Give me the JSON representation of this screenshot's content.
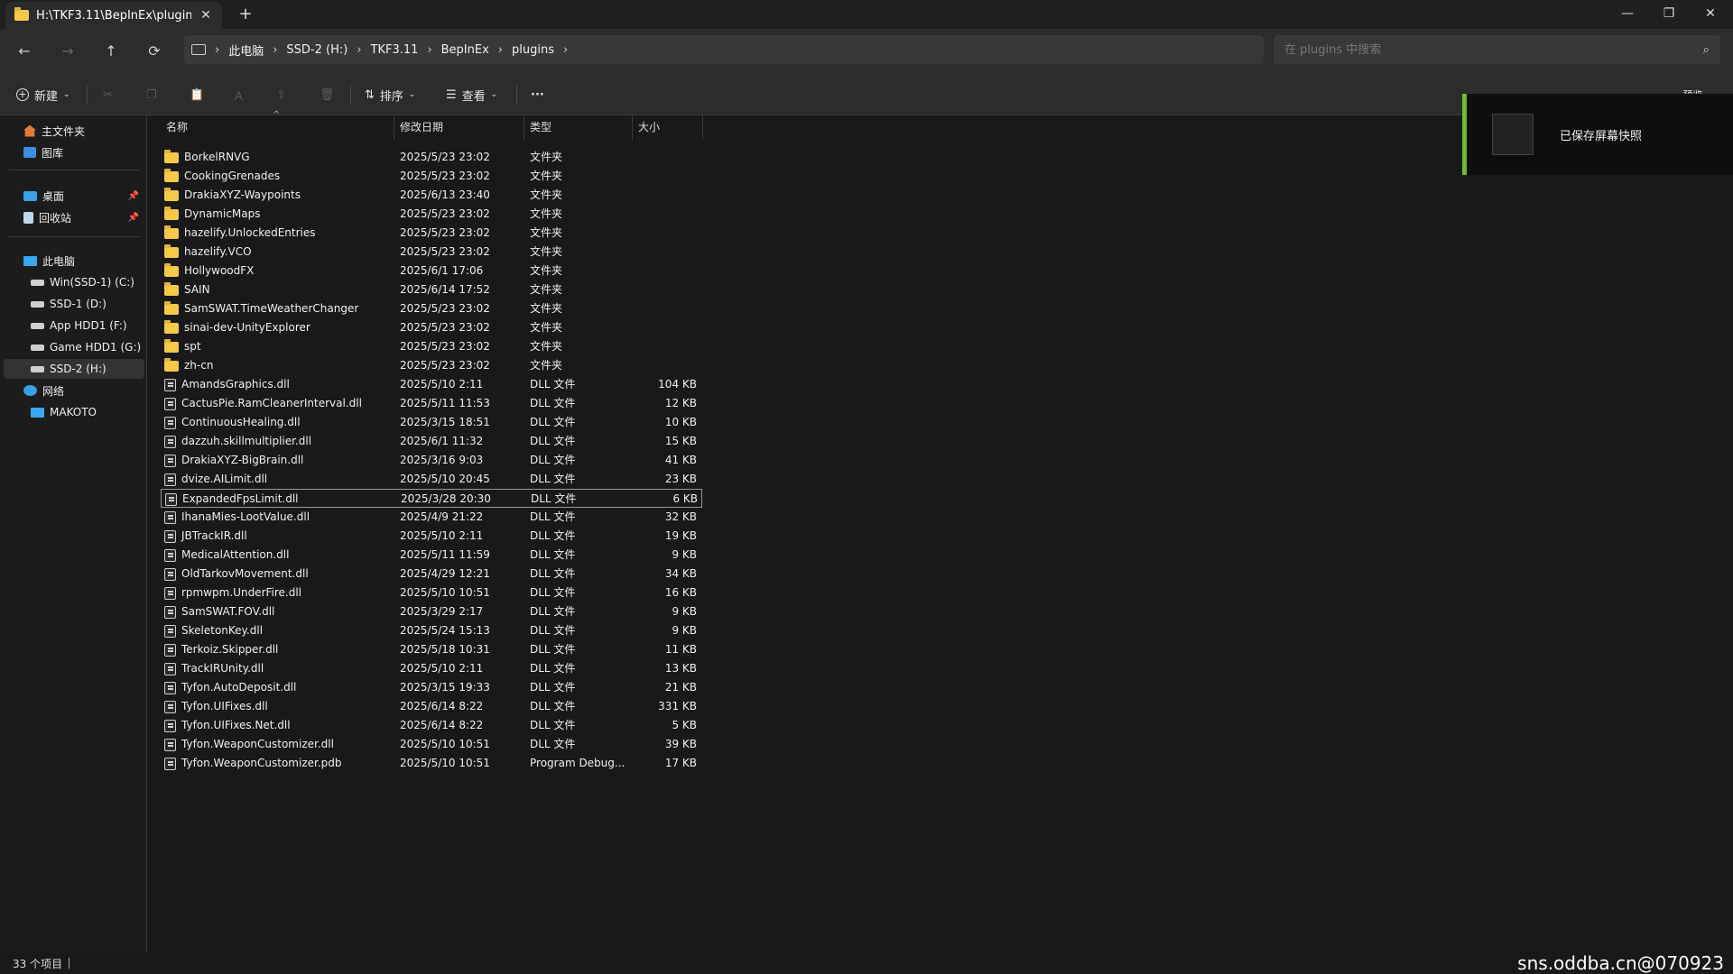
{
  "window": {
    "tab_title": "H:\\TKF3.11\\BepInEx\\plugins",
    "new_tab": "+",
    "min": "—",
    "max": "❐",
    "close": "✕"
  },
  "nav": {
    "back": "←",
    "forward": "→",
    "up": "↑",
    "refresh": "⟳",
    "breadcrumbs": [
      "此电脑",
      "SSD-2 (H:)",
      "TKF3.11",
      "BepInEx",
      "plugins"
    ],
    "search_placeholder": "在 plugins 中搜索"
  },
  "toolbar": {
    "new_label": "新建",
    "sort_label": "排序",
    "view_label": "查看",
    "more_label": "···",
    "preview_label": "预览"
  },
  "sidebar": {
    "home": "主文件夹",
    "gallery": "图库",
    "desktop": "桌面",
    "recycle": "回收站",
    "this_pc": "此电脑",
    "drives": [
      "Win(SSD-1) (C:)",
      "SSD-1 (D:)",
      "App HDD1 (F:)",
      "Game HDD1 (G:)",
      "SSD-2 (H:)"
    ],
    "network": "网络",
    "network_host": "MAKOTO"
  },
  "columns": {
    "name": "名称",
    "date": "修改日期",
    "type": "类型",
    "size": "大小"
  },
  "files": [
    {
      "name": "BorkelRNVG",
      "date": "2025/5/23 23:02",
      "type": "文件夹",
      "size": "",
      "kind": "folder"
    },
    {
      "name": "CookingGrenades",
      "date": "2025/5/23 23:02",
      "type": "文件夹",
      "size": "",
      "kind": "folder"
    },
    {
      "name": "DrakiaXYZ-Waypoints",
      "date": "2025/6/13 23:40",
      "type": "文件夹",
      "size": "",
      "kind": "folder"
    },
    {
      "name": "DynamicMaps",
      "date": "2025/5/23 23:02",
      "type": "文件夹",
      "size": "",
      "kind": "folder"
    },
    {
      "name": "hazelify.UnlockedEntries",
      "date": "2025/5/23 23:02",
      "type": "文件夹",
      "size": "",
      "kind": "folder"
    },
    {
      "name": "hazelify.VCO",
      "date": "2025/5/23 23:02",
      "type": "文件夹",
      "size": "",
      "kind": "folder"
    },
    {
      "name": "HollywoodFX",
      "date": "2025/6/1 17:06",
      "type": "文件夹",
      "size": "",
      "kind": "folder"
    },
    {
      "name": "SAIN",
      "date": "2025/6/14 17:52",
      "type": "文件夹",
      "size": "",
      "kind": "folder"
    },
    {
      "name": "SamSWAT.TimeWeatherChanger",
      "date": "2025/5/23 23:02",
      "type": "文件夹",
      "size": "",
      "kind": "folder"
    },
    {
      "name": "sinai-dev-UnityExplorer",
      "date": "2025/5/23 23:02",
      "type": "文件夹",
      "size": "",
      "kind": "folder"
    },
    {
      "name": "spt",
      "date": "2025/5/23 23:02",
      "type": "文件夹",
      "size": "",
      "kind": "folder"
    },
    {
      "name": "zh-cn",
      "date": "2025/5/23 23:02",
      "type": "文件夹",
      "size": "",
      "kind": "folder"
    },
    {
      "name": "AmandsGraphics.dll",
      "date": "2025/5/10 2:11",
      "type": "DLL 文件",
      "size": "104 KB",
      "kind": "dll"
    },
    {
      "name": "CactusPie.RamCleanerInterval.dll",
      "date": "2025/5/11 11:53",
      "type": "DLL 文件",
      "size": "12 KB",
      "kind": "dll"
    },
    {
      "name": "ContinuousHealing.dll",
      "date": "2025/3/15 18:51",
      "type": "DLL 文件",
      "size": "10 KB",
      "kind": "dll"
    },
    {
      "name": "dazzuh.skillmultiplier.dll",
      "date": "2025/6/1 11:32",
      "type": "DLL 文件",
      "size": "15 KB",
      "kind": "dll"
    },
    {
      "name": "DrakiaXYZ-BigBrain.dll",
      "date": "2025/3/16 9:03",
      "type": "DLL 文件",
      "size": "41 KB",
      "kind": "dll"
    },
    {
      "name": "dvize.AILimit.dll",
      "date": "2025/5/10 20:45",
      "type": "DLL 文件",
      "size": "23 KB",
      "kind": "dll"
    },
    {
      "name": "ExpandedFpsLimit.dll",
      "date": "2025/3/28 20:30",
      "type": "DLL 文件",
      "size": "6 KB",
      "kind": "dll"
    },
    {
      "name": "IhanaMies-LootValue.dll",
      "date": "2025/4/9 21:22",
      "type": "DLL 文件",
      "size": "32 KB",
      "kind": "dll"
    },
    {
      "name": "JBTrackIR.dll",
      "date": "2025/5/10 2:11",
      "type": "DLL 文件",
      "size": "19 KB",
      "kind": "dll"
    },
    {
      "name": "MedicalAttention.dll",
      "date": "2025/5/11 11:59",
      "type": "DLL 文件",
      "size": "9 KB",
      "kind": "dll"
    },
    {
      "name": "OldTarkovMovement.dll",
      "date": "2025/4/29 12:21",
      "type": "DLL 文件",
      "size": "34 KB",
      "kind": "dll"
    },
    {
      "name": "rpmwpm.UnderFire.dll",
      "date": "2025/5/10 10:51",
      "type": "DLL 文件",
      "size": "16 KB",
      "kind": "dll"
    },
    {
      "name": "SamSWAT.FOV.dll",
      "date": "2025/3/29 2:17",
      "type": "DLL 文件",
      "size": "9 KB",
      "kind": "dll"
    },
    {
      "name": "SkeletonKey.dll",
      "date": "2025/5/24 15:13",
      "type": "DLL 文件",
      "size": "9 KB",
      "kind": "dll"
    },
    {
      "name": "Terkoiz.Skipper.dll",
      "date": "2025/5/18 10:31",
      "type": "DLL 文件",
      "size": "11 KB",
      "kind": "dll"
    },
    {
      "name": "TrackIRUnity.dll",
      "date": "2025/5/10 2:11",
      "type": "DLL 文件",
      "size": "13 KB",
      "kind": "dll"
    },
    {
      "name": "Tyfon.AutoDeposit.dll",
      "date": "2025/3/15 19:33",
      "type": "DLL 文件",
      "size": "21 KB",
      "kind": "dll"
    },
    {
      "name": "Tyfon.UIFixes.dll",
      "date": "2025/6/14 8:22",
      "type": "DLL 文件",
      "size": "331 KB",
      "kind": "dll"
    },
    {
      "name": "Tyfon.UIFixes.Net.dll",
      "date": "2025/6/14 8:22",
      "type": "DLL 文件",
      "size": "5 KB",
      "kind": "dll"
    },
    {
      "name": "Tyfon.WeaponCustomizer.dll",
      "date": "2025/5/10 10:51",
      "type": "DLL 文件",
      "size": "39 KB",
      "kind": "dll"
    },
    {
      "name": "Tyfon.WeaponCustomizer.pdb",
      "date": "2025/5/10 10:51",
      "type": "Program Debug...",
      "size": "17 KB",
      "kind": "pdb"
    }
  ],
  "selected_file": "ExpandedFpsLimit.dll",
  "notification": {
    "text": "已保存屏幕快照"
  },
  "status": {
    "count": "33 个项目"
  },
  "watermark": "sns.oddba.cn@070923"
}
